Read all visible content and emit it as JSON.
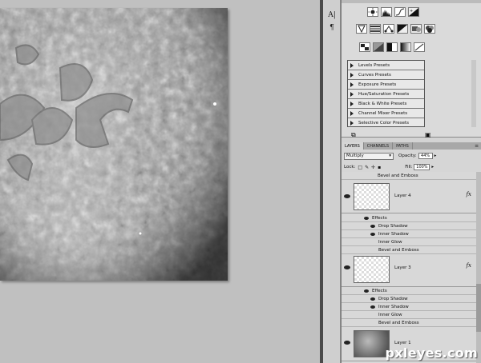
{
  "dock": {
    "char_icon": "A|",
    "para_icon": "¶"
  },
  "presets": [
    "Levels Presets",
    "Curves Presets",
    "Exposure Presets",
    "Hue/Saturation Presets",
    "Black & White Presets",
    "Channel Mixer Presets",
    "Selective Color Presets"
  ],
  "layers_panel": {
    "tabs": [
      "LAYERS",
      "CHANNELS",
      "PATHS"
    ],
    "blend_mode": "Multiply",
    "opacity_label": "Opacity:",
    "opacity_value": "44%",
    "lock_label": "Lock:",
    "fill_label": "Fill:",
    "fill_value": "100%",
    "top_effect": "Bevel and Emboss",
    "layers": [
      {
        "name": "Layer 4",
        "fx": "fx",
        "effects_label": "Effects",
        "effects": [
          "Drop Shadow",
          "Inner Shadow",
          "Inner Glow",
          "Bevel and Emboss"
        ]
      },
      {
        "name": "Layer 3",
        "fx": "fx",
        "effects_label": "Effects",
        "effects": [
          "Drop Shadow",
          "Inner Shadow",
          "Inner Glow",
          "Bevel and Emboss"
        ]
      },
      {
        "name": "Layer 1"
      }
    ]
  },
  "watermark": "pxleyes.com"
}
